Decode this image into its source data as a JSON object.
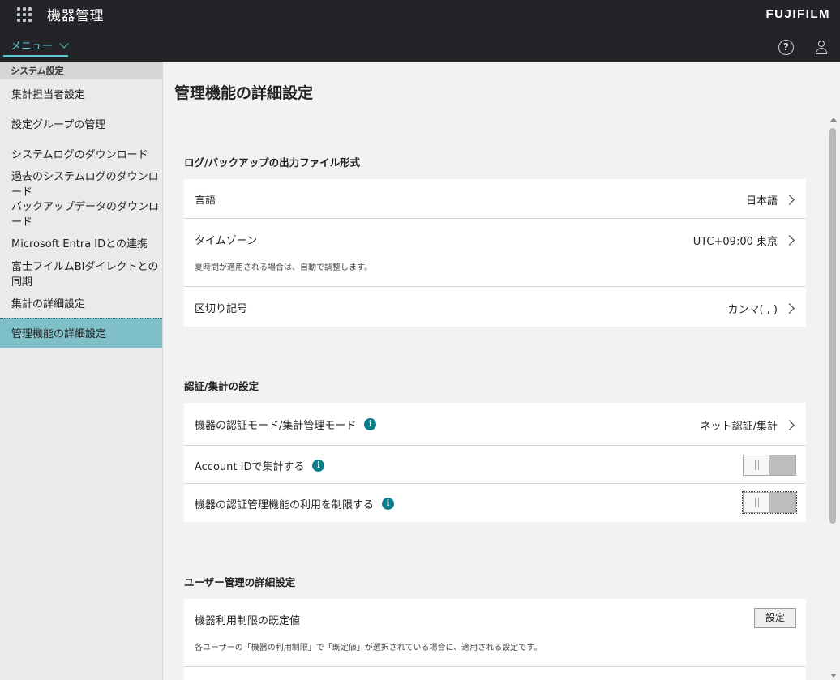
{
  "header": {
    "app_title": "機器管理",
    "brand": "FUJIFILM",
    "menu_label": "メニュー"
  },
  "sidebar": {
    "section_label": "システム設定",
    "items": [
      {
        "label": "集計担当者設定"
      },
      {
        "label": "設定グループの管理"
      },
      {
        "label": "システムログのダウンロード"
      },
      {
        "label": "過去のシステムログのダウンロード"
      },
      {
        "label": "バックアップデータのダウンロード"
      },
      {
        "label": "Microsoft Entra IDとの連携"
      },
      {
        "label": "富士フイルムBIダイレクトとの同期"
      },
      {
        "label": "集計の詳細設定"
      },
      {
        "label": "管理機能の詳細設定"
      }
    ],
    "active_index": 8
  },
  "main": {
    "page_title": "管理機能の詳細設定",
    "sections": [
      {
        "title": "ログ/バックアップの出力ファイル形式",
        "rows": [
          {
            "label": "言語",
            "value": "日本語"
          },
          {
            "label": "タイムゾーン",
            "value": "UTC+09:00 東京",
            "sub": "夏時間が適用される場合は、自動で調整します。"
          },
          {
            "label": "区切り記号",
            "value": "カンマ( , )"
          }
        ]
      },
      {
        "title": "認証/集計の設定",
        "rows": [
          {
            "label": "機器の認証モード/集計管理モード",
            "value": "ネット認証/集計",
            "info": "i"
          },
          {
            "label": "Account IDで集計する",
            "info": "i",
            "toggle_on": false
          },
          {
            "label": "機器の認証管理機能の利用を制限する",
            "info": "i",
            "toggle_on": false
          }
        ]
      },
      {
        "title": "ユーザー管理の詳細設定",
        "rows": [
          {
            "label": "機器利用制限の既定値",
            "button": "設定",
            "sub": "各ユーザーの「機器の利用制限」で「既定値」が選択されている場合に、適用される設定です。"
          }
        ]
      }
    ]
  },
  "colors": {
    "header_bg": "#222428",
    "accent": "#5ec8d6",
    "active_item": "#7fbfc7",
    "info_icon": "#0a7f8c"
  }
}
